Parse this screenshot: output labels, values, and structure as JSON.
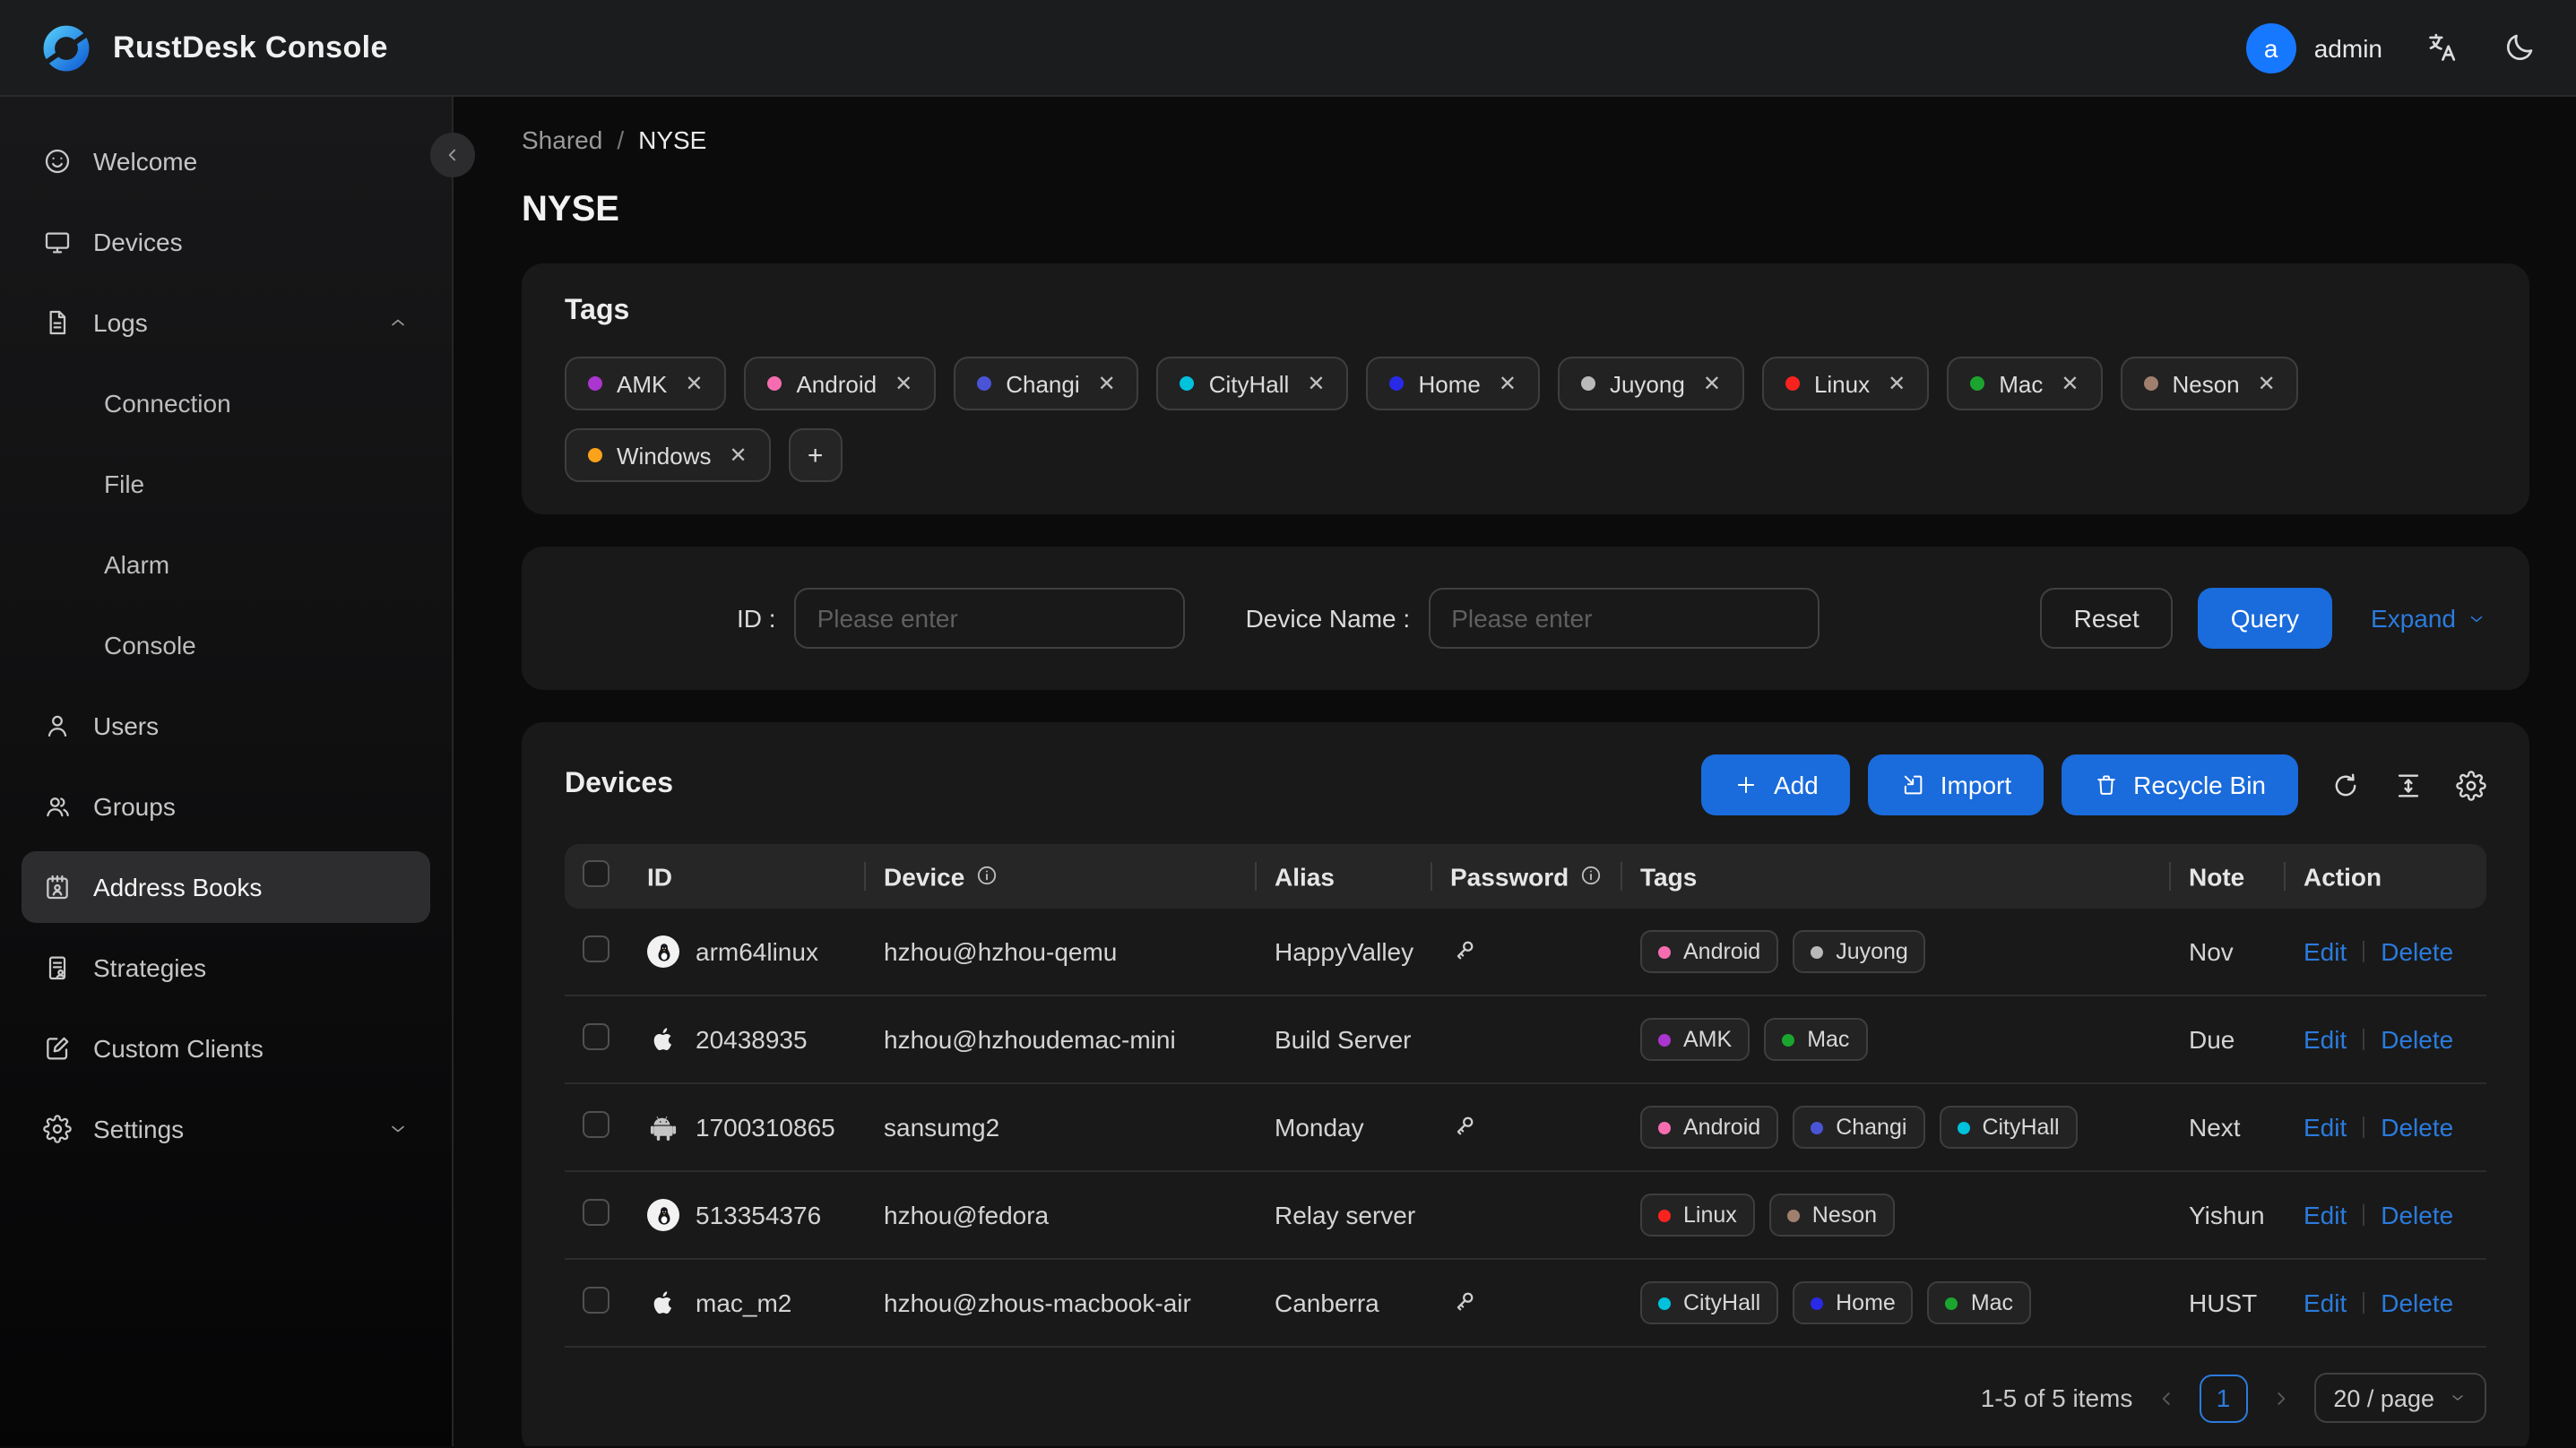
{
  "topbar": {
    "brand": "RustDesk Console",
    "user": "admin",
    "avatar_letter": "a",
    "icons": [
      "language-icon",
      "moon-icon"
    ]
  },
  "sidebar": {
    "items": [
      {
        "label": "Welcome",
        "icon": "smiley-icon",
        "type": "main"
      },
      {
        "label": "Devices",
        "icon": "monitor-icon",
        "type": "main"
      },
      {
        "label": "Logs",
        "icon": "document-icon",
        "type": "main",
        "chevron": "up"
      },
      {
        "label": "Connection",
        "type": "sub"
      },
      {
        "label": "File",
        "type": "sub"
      },
      {
        "label": "Alarm",
        "type": "sub"
      },
      {
        "label": "Console",
        "type": "sub"
      },
      {
        "label": "Users",
        "icon": "user-icon",
        "type": "main"
      },
      {
        "label": "Groups",
        "icon": "users-icon",
        "type": "main"
      },
      {
        "label": "Address Books",
        "icon": "address-book-icon",
        "type": "main",
        "active": true
      },
      {
        "label": "Strategies",
        "icon": "strategy-icon",
        "type": "main"
      },
      {
        "label": "Custom Clients",
        "icon": "edit-square-icon",
        "type": "main"
      },
      {
        "label": "Settings",
        "icon": "gear-icon",
        "type": "main",
        "chevron": "down"
      }
    ]
  },
  "breadcrumb": {
    "parent": "Shared",
    "separator": "/",
    "current": "NYSE"
  },
  "page_title": "NYSE",
  "tags_card": {
    "title": "Tags",
    "add_button": "+",
    "remove_icon": "✕",
    "tags": [
      {
        "label": "AMK",
        "color": "#ab35cf"
      },
      {
        "label": "Android",
        "color": "#f56db0"
      },
      {
        "label": "Changi",
        "color": "#4a54d6"
      },
      {
        "label": "CityHall",
        "color": "#00c2dd"
      },
      {
        "label": "Home",
        "color": "#2929e8"
      },
      {
        "label": "Juyong",
        "color": "#b9b9b9"
      },
      {
        "label": "Linux",
        "color": "#f8231f"
      },
      {
        "label": "Mac",
        "color": "#1ca52e"
      },
      {
        "label": "Neson",
        "color": "#a07f6f"
      },
      {
        "label": "Windows",
        "color": "#faa219"
      }
    ]
  },
  "filter": {
    "id_label": "ID :",
    "device_name_label": "Device Name :",
    "placeholder": "Please enter",
    "reset": "Reset",
    "query": "Query",
    "expand": "Expand"
  },
  "devices_card": {
    "title": "Devices",
    "add": "Add",
    "import": "Import",
    "recycle_bin": "Recycle Bin",
    "tool_icons": [
      "reload-icon",
      "column-height-icon",
      "gear-icon"
    ]
  },
  "table": {
    "columns": [
      {
        "label": "ID"
      },
      {
        "label": "Device",
        "info": true
      },
      {
        "label": "Alias"
      },
      {
        "label": "Password",
        "info": true
      },
      {
        "label": "Tags"
      },
      {
        "label": "Note"
      },
      {
        "label": "Action"
      }
    ],
    "rows": [
      {
        "os": "linux",
        "id": "arm64linux",
        "device": "hzhou@hzhou-qemu",
        "alias": "HappyValley",
        "has_password_key": true,
        "tags": [
          "Android",
          "Juyong"
        ],
        "note": "Nov"
      },
      {
        "os": "apple",
        "id": "20438935",
        "device": "hzhou@hzhoudemac-mini",
        "alias": "Build Server",
        "has_password_key": false,
        "tags": [
          "AMK",
          "Mac"
        ],
        "note": "Due"
      },
      {
        "os": "android",
        "id": "1700310865",
        "device": "sansumg2",
        "alias": "Monday",
        "has_password_key": true,
        "tags": [
          "Android",
          "Changi",
          "CityHall"
        ],
        "note": "Next"
      },
      {
        "os": "linux",
        "id": "513354376",
        "device": "hzhou@fedora",
        "alias": "Relay server",
        "has_password_key": false,
        "tags": [
          "Linux",
          "Neson"
        ],
        "note": "Yishun"
      },
      {
        "os": "apple",
        "id": "mac_m2",
        "device": "hzhou@zhous-macbook-air",
        "alias": "Canberra",
        "has_password_key": true,
        "tags": [
          "CityHall",
          "Home",
          "Mac"
        ],
        "note": "HUST"
      }
    ],
    "actions": {
      "edit": "Edit",
      "delete": "Delete"
    }
  },
  "pagination": {
    "total": "1-5 of 5 items",
    "page": "1",
    "page_size": "20 / page"
  },
  "colors": {
    "primary": "#1a6bdb",
    "link": "#2b7bdd",
    "avatar": "#1677ff",
    "tag_colors": {
      "AMK": "#ab35cf",
      "Android": "#f56db0",
      "Changi": "#4a54d6",
      "CityHall": "#00c2dd",
      "Home": "#2929e8",
      "Juyong": "#b9b9b9",
      "Linux": "#f8231f",
      "Mac": "#1ca52e",
      "Neson": "#a07f6f",
      "Windows": "#faa219"
    }
  }
}
